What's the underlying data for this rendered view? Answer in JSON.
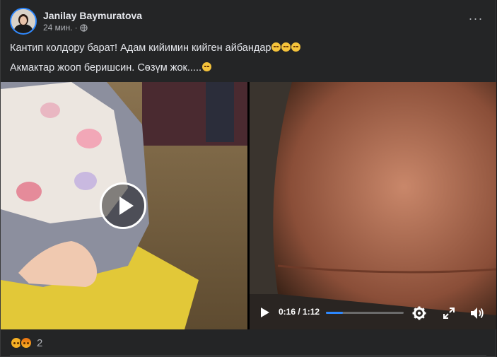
{
  "post": {
    "author": "Janilay Baymuratova",
    "time": "24 мин.",
    "separator": "·",
    "audience_icon": "globe-icon",
    "more_label": "···",
    "line1": "Кантип колдору барат! Адам кийимин кийген айбандар",
    "line2": "Акмактар жооп беришсин. Сөзүм жок.....",
    "line1_emojis": [
      "disappointed-emoji",
      "disappointed-emoji",
      "disappointed-emoji"
    ],
    "line2_emojis": [
      "sad-emoji"
    ]
  },
  "video": {
    "current_time": "0:16",
    "duration": "1:12",
    "time_text": "0:16 / 1:12",
    "progress": 0.22,
    "icons": [
      "play-icon",
      "settings-icon",
      "fullscreen-icon",
      "volume-icon"
    ]
  },
  "reactions": {
    "types": [
      "sad",
      "angry"
    ],
    "count": "2"
  },
  "colors": {
    "background": "#242526",
    "accent": "#2d88ff",
    "text": "#e4e6eb",
    "secondary_text": "#b0b3b8"
  }
}
